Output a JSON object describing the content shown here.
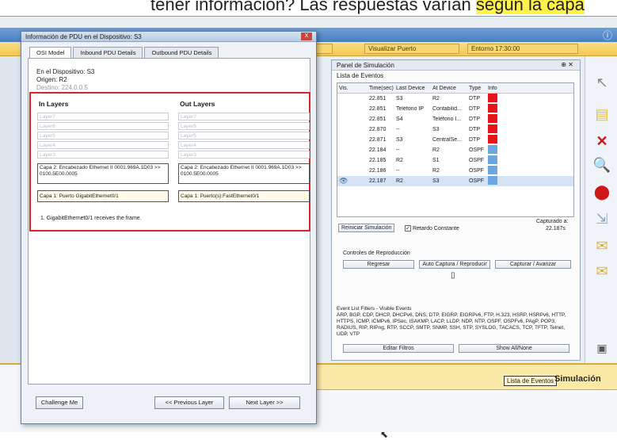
{
  "caption": {
    "text_plain": "tener información? Las respuestas varían ",
    "text_highlight": "según la capa"
  },
  "toolbar": {
    "segment_1": "Visualizar Puerto",
    "segment_2": "Entorno 17:30:00"
  },
  "dialog": {
    "title": "Información de PDU en el Dispositivo: S3",
    "close_label": "X",
    "tabs": [
      "OSI Model",
      "Inbound PDU Details",
      "Outbound PDU Details"
    ],
    "device_line": "En el Dispositivo: S3",
    "source_line": "Origen: R2",
    "dest_line": "Destino: 224.0.0.5",
    "in_title": "In Layers",
    "out_title": "Out Layers",
    "in_layers": [
      "Layer7",
      "Layer6",
      "Layer5",
      "Layer4",
      "Layer3"
    ],
    "out_layers": [
      "Layer7",
      "Layer6",
      "Layer5",
      "Layer4",
      "Layer3"
    ],
    "in_layer2": "Capa 2: Encabezado Ethernet II 0001.969A.1D03 >> 0100.5E00.0005",
    "out_layer2": "Capa 2: Encabezado Ethernet II 0001.969A.1D03 >> 0100.5E00.0005",
    "in_layer1": "Capa 1: Puerto GigabitEthernet0/1",
    "out_layer1": "Capa 1: Puerto(s):FastEthernet0/1",
    "description": "1. GigabitEthernet0/1 receives the frame.",
    "challenge_button": "Challenge Me",
    "prev_button": "<< Previous Layer",
    "next_button": "Next Layer >>"
  },
  "sim_panel": {
    "title": "Panel de Simulación",
    "events_label": "Lista de Eventos",
    "columns": [
      "Vis.",
      "Time(sec)",
      "Last Device",
      "At Device",
      "Type",
      "Info"
    ],
    "rows": [
      {
        "time": "22.851",
        "last": "S3",
        "at": "R2",
        "type": "DTP",
        "color": "#e8131b",
        "vis": ""
      },
      {
        "time": "22.851",
        "last": "Teléfono IP",
        "at": "Contabilid...",
        "type": "DTP",
        "color": "#e8131b",
        "vis": ""
      },
      {
        "time": "22.851",
        "last": "S4",
        "at": "Teléfono I...",
        "type": "DTP",
        "color": "#e8131b",
        "vis": ""
      },
      {
        "time": "22.870",
        "last": "--",
        "at": "S3",
        "type": "DTP",
        "color": "#e8131b",
        "vis": ""
      },
      {
        "time": "22.871",
        "last": "S3",
        "at": "CentralSe...",
        "type": "DTP",
        "color": "#e8131b",
        "vis": ""
      },
      {
        "time": "22.184",
        "last": "--",
        "at": "R2",
        "type": "OSPF",
        "color": "#6aa6e0",
        "vis": ""
      },
      {
        "time": "22.185",
        "last": "R2",
        "at": "S1",
        "type": "OSPF",
        "color": "#6aa6e0",
        "vis": ""
      },
      {
        "time": "22.186",
        "last": "--",
        "at": "R2",
        "type": "OSPF",
        "color": "#6aa6e0",
        "vis": ""
      },
      {
        "time": "22.187",
        "last": "R2",
        "at": "S3",
        "type": "OSPF",
        "color": "#6aa6e0",
        "vis": "👁"
      }
    ],
    "reset_button": "Reiniciar Simulación",
    "constant_delay": "Retardo Constante",
    "captured_label": "Capturado a:",
    "captured_value": "22.187s",
    "controls_label": "Controles de Reproducción",
    "back_button": "Regresar",
    "autoplay_button": "Auto Captura / Reproducir",
    "capture_button": "Capturar / Avanzar",
    "filters_label": "Event List Filters - Visible Events",
    "filters_text": "ARP, BGP, CDP, DHCP, DHCPv6, DNS, DTP, EIGRP, EIGRPv6, FTP, H.323, HSRP, HSRPv6, HTTP, HTTPS, ICMP, ICMPv6, IPSec, ISAKMP, LACP, LLDP, NDP, NTP, OSPF, OSPFv6, PAgP, POP3, RADIUS, RIP, RIPng, RTP, SCCP, SMTP, SNMP, SSH, STP, SYSLOG, TACACS, TCP, TFTP, Telnet, UDP, VTP",
    "edit_filters_button": "Editar Filtros",
    "show_all_button": "Show All/None"
  },
  "bottom": {
    "events_tab": "Lista de Eventos",
    "sim_label": "Simulación"
  }
}
